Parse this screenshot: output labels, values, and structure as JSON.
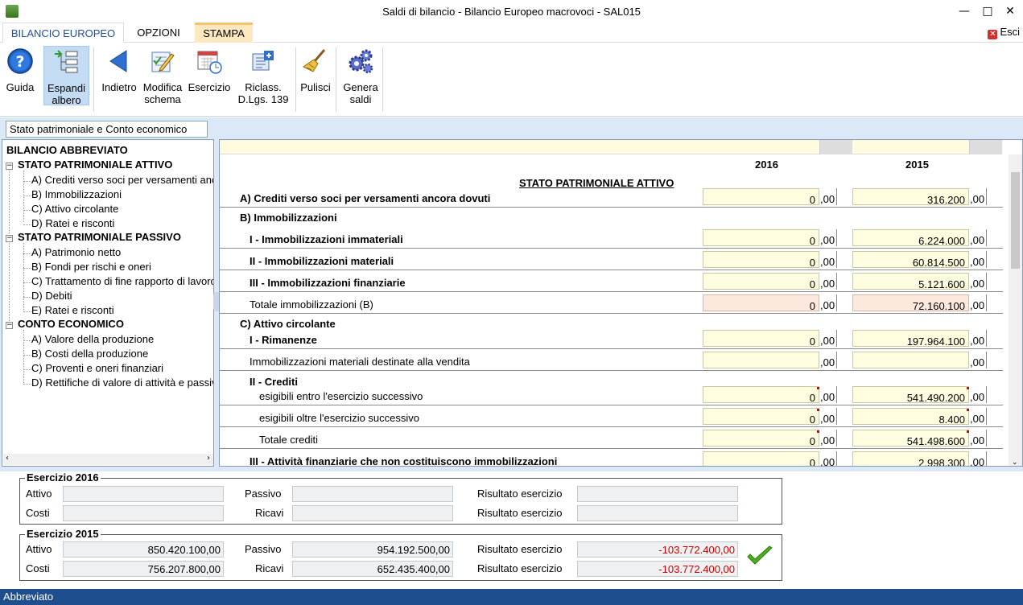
{
  "window": {
    "title": "Saldi di bilancio - Bilancio Europeo macrovoci - SAL015",
    "minimize": "—",
    "maximize": "□",
    "close": "✕"
  },
  "menu": {
    "tabs": [
      "BILANCIO EUROPEO",
      "OPZIONI",
      "STAMPA"
    ],
    "exit_label": "Esci"
  },
  "ribbon": {
    "buttons": [
      {
        "label1": "Guida",
        "label2": "",
        "icon": "help-icon"
      },
      {
        "label1": "Espandi",
        "label2": "albero",
        "icon": "expand-tree-icon"
      },
      {
        "label1": "Indietro",
        "label2": "",
        "icon": "back-arrow-icon"
      },
      {
        "label1": "Modifica",
        "label2": "schema",
        "icon": "edit-schema-icon"
      },
      {
        "label1": "Esercizio",
        "label2": "",
        "icon": "calendar-icon"
      },
      {
        "label1": "Riclass.",
        "label2": "D.Lgs. 139",
        "icon": "reclassify-icon"
      },
      {
        "label1": "Pulisci",
        "label2": "",
        "icon": "broom-icon"
      },
      {
        "label1": "Genera",
        "label2": "saldi",
        "icon": "gears-icon"
      }
    ]
  },
  "subtab": {
    "label": "Stato patrimoniale e Conto economico"
  },
  "tree": {
    "root": "BILANCIO ABBREVIATO",
    "groups": [
      {
        "label": "STATO PATRIMONIALE ATTIVO",
        "items": [
          "A) Crediti verso soci per versamenti ancora dovuti",
          "B) Immobilizzazioni",
          "C) Attivo circolante",
          "D) Ratei e risconti"
        ]
      },
      {
        "label": "STATO PATRIMONIALE PASSIVO",
        "items": [
          "A) Patrimonio netto",
          "B) Fondi per rischi e oneri",
          "C) Trattamento di fine rapporto di lavoro subordinato",
          "D) Debiti",
          "E) Ratei e risconti"
        ]
      },
      {
        "label": "CONTO ECONOMICO",
        "items": [
          "A) Valore della produzione",
          "B) Costi della produzione",
          "C) Proventi e oneri finanziari",
          "D) Rettifiche di valore di attività e passività finanziarie"
        ]
      }
    ],
    "expand_symbol": "−"
  },
  "grid": {
    "year1": "2016",
    "year2": "2015",
    "section": "STATO PATRIMONIALE ATTIVO",
    "decimal": ",00",
    "rows": [
      {
        "label": "A) Crediti verso soci per versamenti ancora dovuti",
        "bold": true,
        "v1": "0",
        "v2": "316.200"
      },
      {
        "label": "B) Immobilizzazioni",
        "bold": true
      },
      {
        "label": "I - Immobilizzazioni immateriali",
        "bold": true,
        "v1": "0",
        "v2": "6.224.000"
      },
      {
        "label": "II - Immobilizzazioni materiali",
        "bold": true,
        "v1": "0",
        "v2": "60.814.500"
      },
      {
        "label": "III - Immobilizzazioni finanziarie",
        "bold": true,
        "v1": "0",
        "v2": "5.121.600"
      },
      {
        "label": "Totale immobilizzazioni (B)",
        "bold": false,
        "v1": "0",
        "v2": "72.160.100"
      },
      {
        "label": "C) Attivo circolante",
        "bold": true
      },
      {
        "label": "I - Rimanenze",
        "bold": true,
        "v1": "0",
        "v2": "197.964.100"
      },
      {
        "label": "Immobilizzazioni materiali destinate alla vendita",
        "bold": false,
        "v1": "",
        "v2": ""
      },
      {
        "label": "II - Crediti",
        "bold": true
      },
      {
        "label": "esigibili entro l'esercizio successivo",
        "bold": false,
        "v1": "0",
        "v2": "541.490.200"
      },
      {
        "label": "esigibili oltre l'esercizio successivo",
        "bold": false,
        "v1": "0",
        "v2": "8.400"
      },
      {
        "label": "Totale crediti",
        "bold": false,
        "v1": "0",
        "v2": "541.498.600"
      },
      {
        "label": "III - Attività finanziarie che non costituiscono immobilizzazioni",
        "bold": true,
        "v1": "0",
        "v2": "2.998.300"
      }
    ]
  },
  "summary": {
    "p2016": {
      "title": "Esercizio 2016",
      "attivo_label": "Attivo",
      "attivo": "",
      "costi_label": "Costi",
      "costi": "",
      "passivo_label": "Passivo",
      "passivo": "",
      "ricavi_label": "Ricavi",
      "ricavi": "",
      "risultato_label": "Risultato esercizio",
      "risultato1": "",
      "risultato2": ""
    },
    "p2015": {
      "title": "Esercizio 2015",
      "attivo_label": "Attivo",
      "attivo": "850.420.100,00",
      "costi_label": "Costi",
      "costi": "756.207.800,00",
      "passivo_label": "Passivo",
      "passivo": "954.192.500,00",
      "ricavi_label": "Ricavi",
      "ricavi": "652.435.400,00",
      "risultato_label": "Risultato esercizio",
      "risultato1": "-103.772.400,00",
      "risultato2": "-103.772.400,00"
    }
  },
  "status": {
    "text": "Abbreviato"
  },
  "colors": {
    "accent": "#1f4e8f",
    "negative": "#d00000",
    "cell_bg": "#fffde0",
    "total_bg": "#fce8dc"
  }
}
